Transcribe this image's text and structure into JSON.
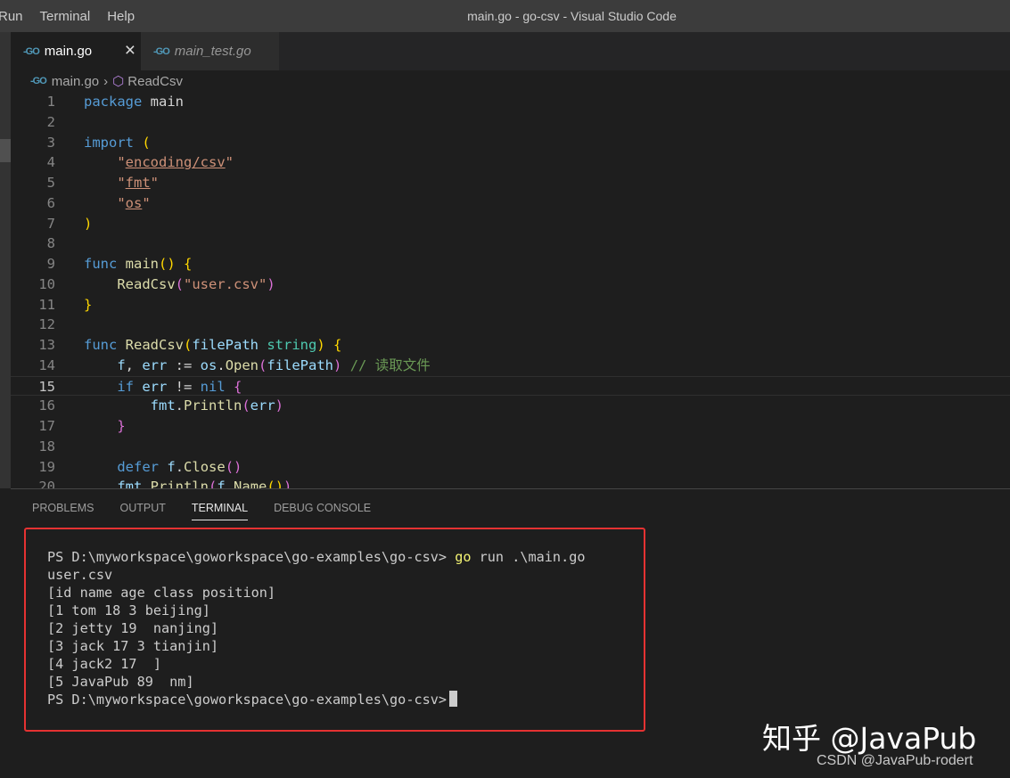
{
  "menu": [
    "Run",
    "Terminal",
    "Help"
  ],
  "window_title": "main.go - go-csv - Visual Studio Code",
  "tabs": [
    {
      "label": "main.go",
      "active": true
    },
    {
      "label": "main_test.go",
      "active": false
    }
  ],
  "tab_icon": "go-file-icon",
  "close_glyph": "×",
  "breadcrumb": {
    "file": "main.go",
    "symbol": "ReadCsv"
  },
  "editor": {
    "line_numbers": [
      "1",
      "2",
      "3",
      "4",
      "5",
      "6",
      "7",
      "8",
      "9",
      "10",
      "11",
      "12",
      "13",
      "14",
      "15",
      "16",
      "17",
      "18",
      "19",
      "20"
    ],
    "current_line": 15
  },
  "panel": {
    "tabs": [
      "PROBLEMS",
      "OUTPUT",
      "TERMINAL",
      "DEBUG CONSOLE"
    ],
    "active_tab": "TERMINAL",
    "terminal": {
      "prompt": "PS D:\\myworkspace\\goworkspace\\go-examples\\go-csv> ",
      "command_go": "go",
      "command_rest": " run .\\main.go",
      "output": [
        "user.csv",
        "[id name age class position]",
        "[1 tom 18 3 beijing]",
        "[2 jetty 19  nanjing]",
        "[3 jack 17 3 tianjin]",
        "[4 jack2 17  ]",
        "[5 JavaPub 89  nm]"
      ],
      "final_prompt": "PS D:\\myworkspace\\goworkspace\\go-examples\\go-csv>"
    }
  },
  "watermark": {
    "main": "知乎 @JavaPub",
    "sub": "CSDN @JavaPub-rodert"
  }
}
